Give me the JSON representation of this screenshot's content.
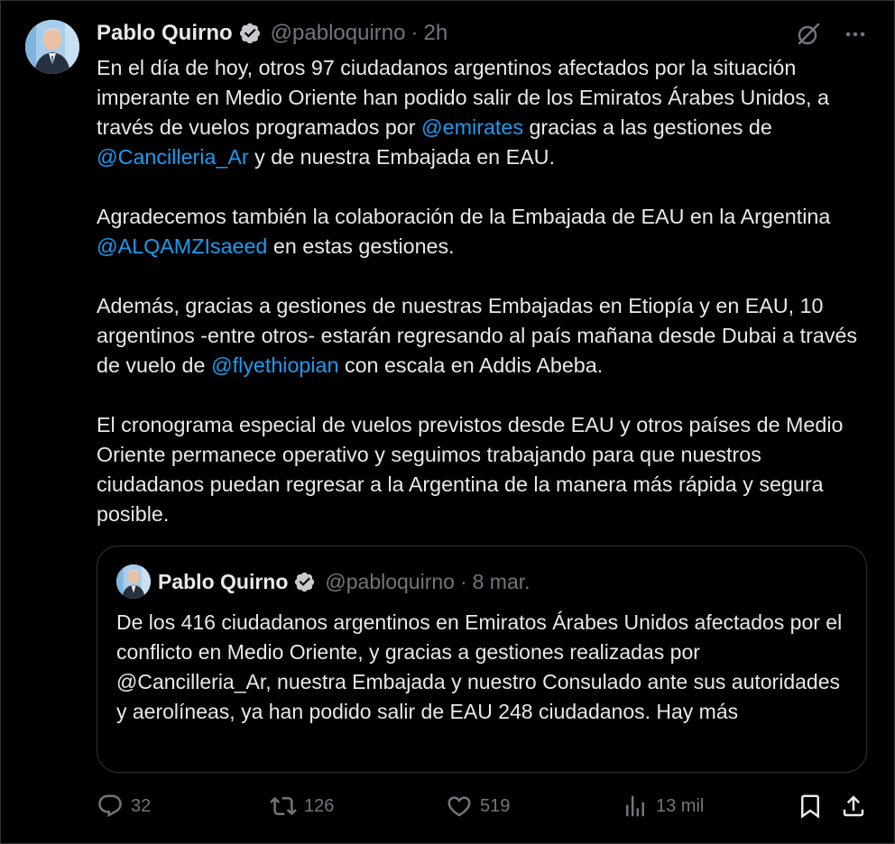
{
  "post": {
    "author_name": "Pablo Quirno",
    "handle": "@pabloquirno",
    "separator": "·",
    "time": "2h",
    "paragraphs": [
      [
        {
          "text": "En el día de hoy, otros 97 ciudadanos argentinos afectados por la situación imperante en Medio Oriente han podido salir de los Emiratos Árabes Unidos, a través de vuelos programados por "
        },
        {
          "text": "@emirates",
          "mention": true
        },
        {
          "text": " gracias a las gestiones de "
        },
        {
          "text": "@Cancilleria_Ar",
          "mention": true
        },
        {
          "text": " y de nuestra Embajada en EAU."
        }
      ],
      [
        {
          "text": "Agradecemos también la colaboración de la Embajada de EAU en la Argentina "
        },
        {
          "text": "@ALQAMZIsaeed",
          "mention": true
        },
        {
          "text": " en estas gestiones."
        }
      ],
      [
        {
          "text": "Además, gracias a gestiones de nuestras Embajadas en Etiopía y en EAU, 10 argentinos -entre otros- estarán regresando al país mañana desde Dubai a través de vuelo de "
        },
        {
          "text": "@flyethiopian",
          "mention": true
        },
        {
          "text": " con escala en Addis Abeba."
        }
      ],
      [
        {
          "text": "El cronograma especial de vuelos previstos desde EAU y otros países de Medio Oriente permanece operativo y seguimos trabajando para que nuestros ciudadanos puedan regresar a la Argentina de la manera más rápida y segura posible."
        }
      ]
    ]
  },
  "quote": {
    "author_name": "Pablo Quirno",
    "handle": "@pabloquirno",
    "separator": "·",
    "time": "8 mar.",
    "text": "De los 416 ciudadanos argentinos en Emiratos Árabes Unidos afectados por el conflicto en Medio Oriente, y gracias a gestiones realizadas por @Cancilleria_Ar, nuestra Embajada y nuestro Consulado ante sus autoridades y aerolíneas, ya han podido salir de EAU 248 ciudadanos. Hay más"
  },
  "actions": {
    "replies": "32",
    "reposts": "126",
    "likes": "519",
    "views": "13 mil"
  },
  "icons": {
    "verified": "verified-badge-icon",
    "grok": "grok-icon",
    "more": "more-icon",
    "reply": "reply-icon",
    "repost": "repost-icon",
    "like": "heart-icon",
    "views": "views-chart-icon",
    "bookmark": "bookmark-icon",
    "share": "share-icon"
  },
  "colors": {
    "background": "#000000",
    "text": "#e7e9ea",
    "secondary": "#71767b",
    "link": "#1d9bf0",
    "border": "#2f3336"
  }
}
